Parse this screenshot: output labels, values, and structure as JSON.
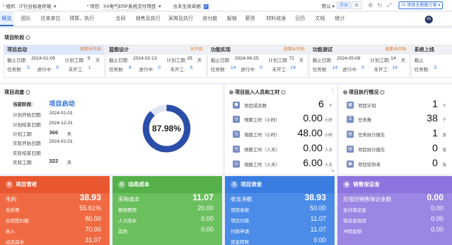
{
  "topbar": {
    "org_label": "* 组织:",
    "org_value": "IT行业标准环境",
    "project_label": "* 项目:",
    "project_value": "XX电气ERP系统交付项目",
    "include_unapproved_label": "含未生效单据:",
    "default_label": "默认",
    "unit_wan": "万元",
    "unit_yuan": "元",
    "scheme_label": "项目全貌路方案"
  },
  "tabs": [
    "概览",
    "团队",
    "往来单位",
    "预算、执行",
    "合同",
    "销售及执行",
    "采购及执行",
    "收付款",
    "报销",
    "薪资",
    "材料收发",
    "日历",
    "文档",
    "统计"
  ],
  "avatar": "AI",
  "stages_section": {
    "title": "项目阶段",
    "stages": [
      {
        "name": "项目启动",
        "status": "逾期未开始",
        "status_color": "#e8792a",
        "rows": [
          [
            "截止日期",
            "2024-01-09",
            "计划工期:",
            "9",
            "天"
          ],
          [
            "任务数:",
            "3",
            "进行中:",
            "0",
            "未开工:",
            "1"
          ]
        ]
      },
      {
        "name": "蓝图设计",
        "status": "未开始",
        "status_color": "#e8792a",
        "rows": [
          [
            "截止日期",
            "2024-02-13",
            "计划工期:",
            "35",
            "天"
          ],
          [
            "任务数:",
            "8",
            "进行中:",
            "0",
            "未开工:",
            "8"
          ]
        ]
      },
      {
        "name": "功能实现",
        "status": "逾期未开始",
        "status_color": "#e8792a",
        "rows": [
          [
            "截止日期",
            "2024-04-25",
            "计划工期:",
            "72",
            "天"
          ],
          [
            "任务数:",
            "14",
            "进行中:",
            "0",
            "未开工:",
            "14"
          ]
        ]
      },
      {
        "name": "功能测试",
        "status": "逾期未开始",
        "status_color": "#e8792a",
        "rows": [
          [
            "截止日期",
            "2024-05-08",
            "计划工期:",
            "14",
            "天"
          ],
          [
            "任务数:",
            "14",
            "进行中:",
            "0",
            "未开工:",
            "14"
          ]
        ]
      },
      {
        "name": "系统上线",
        "status": "",
        "status_color": "#e8792a",
        "rows": [
          [
            "截止",
            "",
            ""
          ],
          [
            "任务数:",
            "5",
            ""
          ]
        ]
      }
    ]
  },
  "progress": {
    "title": "项目进度",
    "current_stage_label": "当前阶段:",
    "current_stage": "项目启动",
    "rows": [
      [
        "计划开始日期",
        "2024-01-01",
        ""
      ],
      [
        "计划结束日期",
        "2024-12-31",
        ""
      ],
      [
        "计划工期:",
        "366",
        "天"
      ],
      [
        "实际开始日期",
        "2024-01-01",
        ""
      ],
      [
        "实际结束日期",
        "",
        ""
      ],
      [
        "实际工期:",
        "322",
        "天"
      ]
    ],
    "percent_text": "87.98%",
    "percent": 0.8798
  },
  "manpower": {
    "title": "项目投入人员和工时",
    "rows": [
      {
        "icon": "people-icon",
        "label": "项目成员数",
        "value": "6",
        "unit": "个"
      },
      {
        "icon": "clock-icon",
        "label": "预算工时（小时）",
        "value": "0.00",
        "unit": "小时"
      },
      {
        "icon": "clock-icon",
        "label": "填报工时（小时）",
        "value": "48.00",
        "unit": "小时"
      },
      {
        "icon": "clock-icon",
        "label": "预算工时（人天）",
        "value": "0.00",
        "unit": "人天"
      },
      {
        "icon": "clock-icon",
        "label": "填报工时（人天）",
        "value": "6.00",
        "unit": "人天"
      }
    ]
  },
  "execution": {
    "title": "项目执行情况",
    "rows": [
      {
        "label": "项目计划",
        "value": "1",
        "unit": "个"
      },
      {
        "label": "任务数",
        "value": "38",
        "unit": "个"
      },
      {
        "label": "任务执行报告",
        "value": "1",
        "unit": "张"
      },
      {
        "label": "项目执行报告",
        "value": "0",
        "unit": "张"
      },
      {
        "label": "项目结项单",
        "value": "0",
        "unit": "张"
      }
    ]
  },
  "revenue": {
    "title": "项目营收",
    "color": "#e8572f",
    "rows": [
      [
        "毛利",
        "38.93"
      ],
      [
        "毛利率",
        "55.61%"
      ],
      [
        "合同签约额",
        "80.00"
      ],
      [
        "收入",
        "70.00"
      ],
      [
        "动态成本",
        "31.07"
      ]
    ]
  },
  "cost": {
    "title": "动态成本",
    "color": "#55b04a",
    "rows": [
      [
        "采购成本",
        "11.07"
      ],
      [
        "报销费用",
        "20.00"
      ],
      [
        "人力成本",
        "0.00"
      ],
      [
        "其他",
        "0.00"
      ]
    ]
  },
  "funds": {
    "title": "项目资金",
    "color": "#3a7de0",
    "rows": [
      [
        "收支净额",
        "38.93"
      ],
      [
        "项目收款",
        "50.00"
      ],
      [
        "项目付款",
        "11.07"
      ],
      [
        "付款申请",
        "11.07"
      ],
      [
        "资金转账",
        "0.00"
      ]
    ]
  },
  "bond": {
    "title": "销售保证金",
    "color": "#8c73de",
    "rows": [
      [
        "应收回销售保证金额",
        "0.00"
      ],
      [
        "支付保证金",
        "0.00"
      ],
      [
        "保证金收回",
        "0.00"
      ],
      [
        "冲销金额",
        "0.00"
      ]
    ]
  }
}
